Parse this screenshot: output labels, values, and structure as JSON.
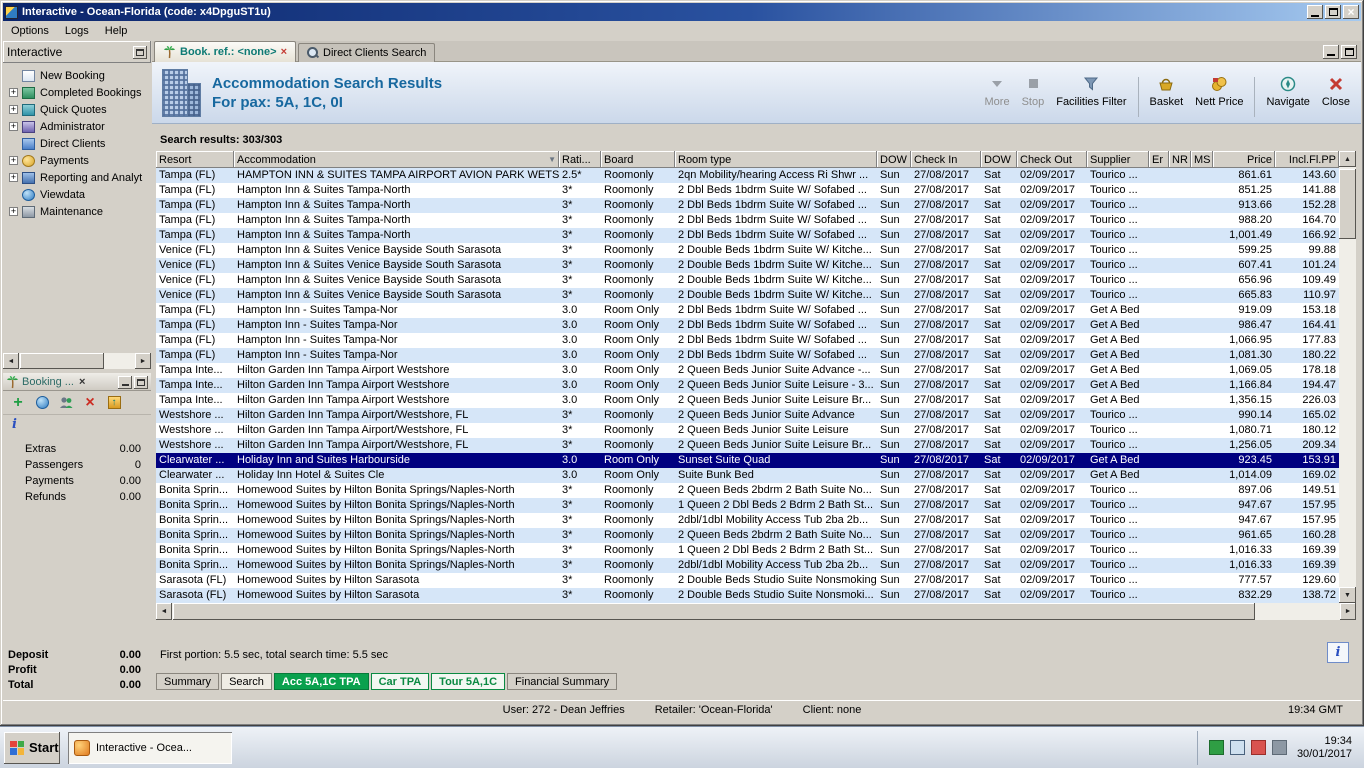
{
  "window": {
    "title": "Interactive - Ocean-Florida (code: x4DpguST1u)",
    "menu": [
      "Options",
      "Logs",
      "Help"
    ]
  },
  "sidebar": {
    "title": "Interactive",
    "items": [
      {
        "label": "New Booking",
        "icon": "new-booking-icon"
      },
      {
        "label": "Completed Bookings",
        "icon": "completed-bookings-icon",
        "expandable": true
      },
      {
        "label": "Quick Quotes",
        "icon": "quick-quotes-icon",
        "expandable": true
      },
      {
        "label": "Administrator",
        "icon": "administrator-icon",
        "expandable": true
      },
      {
        "label": "Direct Clients",
        "icon": "direct-clients-icon"
      },
      {
        "label": "Payments",
        "icon": "payments-icon",
        "expandable": true
      },
      {
        "label": "Reporting and Analyt",
        "icon": "reporting-icon",
        "expandable": true
      },
      {
        "label": "Viewdata",
        "icon": "viewdata-icon"
      },
      {
        "label": "Maintenance",
        "icon": "maintenance-icon",
        "expandable": true
      }
    ]
  },
  "booking_panel": {
    "title": "Booking ...",
    "toolbar_icons": [
      "add-icon",
      "globe-icon",
      "add-passenger-icon",
      "delete-icon",
      "export-icon",
      "info-icon"
    ],
    "fields": [
      {
        "label": "Extras",
        "value": "0.00"
      },
      {
        "label": "Passengers",
        "value": "0"
      },
      {
        "label": "Payments",
        "value": "0.00"
      },
      {
        "label": "Refunds",
        "value": "0.00"
      }
    ],
    "totals": [
      {
        "label": "Deposit",
        "value": "0.00"
      },
      {
        "label": "Profit",
        "value": "0.00"
      },
      {
        "label": "Total",
        "value": "0.00"
      }
    ]
  },
  "main": {
    "tabs": [
      {
        "label": "Book. ref.: <none>",
        "active": true
      },
      {
        "label": "Direct Clients Search"
      }
    ],
    "header": {
      "title": "Accommodation Search Results",
      "subtitle": "For pax: 5A, 1C, 0I"
    },
    "toolbar": [
      {
        "label": "More",
        "icon": "more-icon",
        "disabled": true
      },
      {
        "label": "Stop",
        "icon": "stop-icon",
        "disabled": true
      },
      {
        "label": "Facilities Filter",
        "icon": "facilities-filter-icon"
      },
      {
        "label": "Basket",
        "icon": "basket-icon"
      },
      {
        "label": "Nett Price",
        "icon": "nett-price-icon"
      },
      {
        "label": "Navigate",
        "icon": "navigate-icon"
      },
      {
        "label": "Close",
        "icon": "close-icon"
      }
    ],
    "results_label": "Search results: 303/303",
    "status_line": "First portion: 5.5 sec, total search time: 5.5 sec",
    "bottom_tabs": [
      {
        "label": "Summary"
      },
      {
        "label": "Search",
        "active": true
      },
      {
        "label": "Acc 5A,1C TPA",
        "filled": true
      },
      {
        "label": "Car TPA",
        "outline": true
      },
      {
        "label": "Tour 5A,1C",
        "outline": true
      },
      {
        "label": "Financial Summary"
      }
    ]
  },
  "table": {
    "columns": [
      "Resort",
      "Accommodation",
      "Rati...",
      "Board",
      "Room type",
      "DOW",
      "Check In",
      "DOW",
      "Check Out",
      "Supplier",
      "Er",
      "NR",
      "MS",
      "Price",
      "Incl.Fl.PP"
    ],
    "rows": [
      {
        "r": "Tampa (FL)",
        "a": "HAMPTON INN & SUITES TAMPA AIRPORT AVION PARK WETSH...",
        "rt": "2.5*",
        "b": "Roomonly",
        "rm": "2qn Mobility/hearing Access Ri Shwr ...",
        "d1": "Sun",
        "ci": "27/08/2017",
        "d2": "Sat",
        "co": "02/09/2017",
        "s": "Tourico ...",
        "p": "861.61",
        "pp": "143.60"
      },
      {
        "r": "Tampa (FL)",
        "a": "Hampton Inn & Suites Tampa-North",
        "rt": "3*",
        "b": "Roomonly",
        "rm": "2 Dbl Beds 1bdrm Suite W/ Sofabed ...",
        "d1": "Sun",
        "ci": "27/08/2017",
        "d2": "Sat",
        "co": "02/09/2017",
        "s": "Tourico ...",
        "p": "851.25",
        "pp": "141.88"
      },
      {
        "r": "Tampa (FL)",
        "a": "Hampton Inn & Suites Tampa-North",
        "rt": "3*",
        "b": "Roomonly",
        "rm": "2 Dbl Beds 1bdrm Suite W/ Sofabed ...",
        "d1": "Sun",
        "ci": "27/08/2017",
        "d2": "Sat",
        "co": "02/09/2017",
        "s": "Tourico ...",
        "p": "913.66",
        "pp": "152.28"
      },
      {
        "r": "Tampa (FL)",
        "a": "Hampton Inn & Suites Tampa-North",
        "rt": "3*",
        "b": "Roomonly",
        "rm": "2 Dbl Beds 1bdrm Suite W/ Sofabed ...",
        "d1": "Sun",
        "ci": "27/08/2017",
        "d2": "Sat",
        "co": "02/09/2017",
        "s": "Tourico ...",
        "p": "988.20",
        "pp": "164.70"
      },
      {
        "r": "Tampa (FL)",
        "a": "Hampton Inn & Suites Tampa-North",
        "rt": "3*",
        "b": "Roomonly",
        "rm": "2 Dbl Beds 1bdrm Suite W/ Sofabed ...",
        "d1": "Sun",
        "ci": "27/08/2017",
        "d2": "Sat",
        "co": "02/09/2017",
        "s": "Tourico ...",
        "p": "1,001.49",
        "pp": "166.92"
      },
      {
        "r": "Venice (FL)",
        "a": "Hampton Inn & Suites Venice Bayside South Sarasota",
        "rt": "3*",
        "b": "Roomonly",
        "rm": "2 Double Beds 1bdrm Suite W/ Kitche...",
        "d1": "Sun",
        "ci": "27/08/2017",
        "d2": "Sat",
        "co": "02/09/2017",
        "s": "Tourico ...",
        "p": "599.25",
        "pp": "99.88"
      },
      {
        "r": "Venice (FL)",
        "a": "Hampton Inn & Suites Venice Bayside South Sarasota",
        "rt": "3*",
        "b": "Roomonly",
        "rm": "2 Double Beds 1bdrm Suite W/ Kitche...",
        "d1": "Sun",
        "ci": "27/08/2017",
        "d2": "Sat",
        "co": "02/09/2017",
        "s": "Tourico ...",
        "p": "607.41",
        "pp": "101.24"
      },
      {
        "r": "Venice (FL)",
        "a": "Hampton Inn & Suites Venice Bayside South Sarasota",
        "rt": "3*",
        "b": "Roomonly",
        "rm": "2 Double Beds 1bdrm Suite W/ Kitche...",
        "d1": "Sun",
        "ci": "27/08/2017",
        "d2": "Sat",
        "co": "02/09/2017",
        "s": "Tourico ...",
        "p": "656.96",
        "pp": "109.49"
      },
      {
        "r": "Venice (FL)",
        "a": "Hampton Inn & Suites Venice Bayside South Sarasota",
        "rt": "3*",
        "b": "Roomonly",
        "rm": "2 Double Beds 1bdrm Suite W/ Kitche...",
        "d1": "Sun",
        "ci": "27/08/2017",
        "d2": "Sat",
        "co": "02/09/2017",
        "s": "Tourico ...",
        "p": "665.83",
        "pp": "110.97"
      },
      {
        "r": "Tampa (FL)",
        "a": "Hampton Inn - Suites Tampa-Nor",
        "rt": "3.0",
        "b": "Room Only",
        "rm": "2 Dbl Beds 1bdrm Suite W/ Sofabed ...",
        "d1": "Sun",
        "ci": "27/08/2017",
        "d2": "Sat",
        "co": "02/09/2017",
        "s": "Get A Bed",
        "p": "919.09",
        "pp": "153.18"
      },
      {
        "r": "Tampa (FL)",
        "a": "Hampton Inn - Suites Tampa-Nor",
        "rt": "3.0",
        "b": "Room Only",
        "rm": "2 Dbl Beds 1bdrm Suite W/ Sofabed ...",
        "d1": "Sun",
        "ci": "27/08/2017",
        "d2": "Sat",
        "co": "02/09/2017",
        "s": "Get A Bed",
        "p": "986.47",
        "pp": "164.41"
      },
      {
        "r": "Tampa (FL)",
        "a": "Hampton Inn - Suites Tampa-Nor",
        "rt": "3.0",
        "b": "Room Only",
        "rm": "2 Dbl Beds 1bdrm Suite W/ Sofabed ...",
        "d1": "Sun",
        "ci": "27/08/2017",
        "d2": "Sat",
        "co": "02/09/2017",
        "s": "Get A Bed",
        "p": "1,066.95",
        "pp": "177.83"
      },
      {
        "r": "Tampa (FL)",
        "a": "Hampton Inn - Suites Tampa-Nor",
        "rt": "3.0",
        "b": "Room Only",
        "rm": "2 Dbl Beds 1bdrm Suite W/ Sofabed ...",
        "d1": "Sun",
        "ci": "27/08/2017",
        "d2": "Sat",
        "co": "02/09/2017",
        "s": "Get A Bed",
        "p": "1,081.30",
        "pp": "180.22"
      },
      {
        "r": "Tampa Inte...",
        "a": "Hilton Garden Inn Tampa Airport Westshore",
        "rt": "3.0",
        "b": "Room Only",
        "rm": "2 Queen Beds Junior Suite Advance -...",
        "d1": "Sun",
        "ci": "27/08/2017",
        "d2": "Sat",
        "co": "02/09/2017",
        "s": "Get A Bed",
        "p": "1,069.05",
        "pp": "178.18"
      },
      {
        "r": "Tampa Inte...",
        "a": "Hilton Garden Inn Tampa Airport Westshore",
        "rt": "3.0",
        "b": "Room Only",
        "rm": "2 Queen Beds Junior Suite Leisure - 3...",
        "d1": "Sun",
        "ci": "27/08/2017",
        "d2": "Sat",
        "co": "02/09/2017",
        "s": "Get A Bed",
        "p": "1,166.84",
        "pp": "194.47"
      },
      {
        "r": "Tampa Inte...",
        "a": "Hilton Garden Inn Tampa Airport Westshore",
        "rt": "3.0",
        "b": "Room Only",
        "rm": "2 Queen Beds Junior Suite Leisure Br...",
        "d1": "Sun",
        "ci": "27/08/2017",
        "d2": "Sat",
        "co": "02/09/2017",
        "s": "Get A Bed",
        "p": "1,356.15",
        "pp": "226.03"
      },
      {
        "r": "Westshore ...",
        "a": "Hilton Garden Inn Tampa Airport/Westshore, FL",
        "rt": "3*",
        "b": "Roomonly",
        "rm": "2 Queen Beds Junior Suite Advance",
        "d1": "Sun",
        "ci": "27/08/2017",
        "d2": "Sat",
        "co": "02/09/2017",
        "s": "Tourico ...",
        "p": "990.14",
        "pp": "165.02"
      },
      {
        "r": "Westshore ...",
        "a": "Hilton Garden Inn Tampa Airport/Westshore, FL",
        "rt": "3*",
        "b": "Roomonly",
        "rm": "2 Queen Beds Junior Suite Leisure",
        "d1": "Sun",
        "ci": "27/08/2017",
        "d2": "Sat",
        "co": "02/09/2017",
        "s": "Tourico ...",
        "p": "1,080.71",
        "pp": "180.12"
      },
      {
        "r": "Westshore ...",
        "a": "Hilton Garden Inn Tampa Airport/Westshore, FL",
        "rt": "3*",
        "b": "Roomonly",
        "rm": "2 Queen Beds Junior Suite Leisure Br...",
        "d1": "Sun",
        "ci": "27/08/2017",
        "d2": "Sat",
        "co": "02/09/2017",
        "s": "Tourico ...",
        "p": "1,256.05",
        "pp": "209.34"
      },
      {
        "r": "Clearwater ...",
        "a": "Holiday Inn and Suites Harbourside",
        "rt": "3.0",
        "b": "Room Only",
        "rm": "Sunset Suite Quad",
        "d1": "Sun",
        "ci": "27/08/2017",
        "d2": "Sat",
        "co": "02/09/2017",
        "s": "Get A Bed",
        "p": "923.45",
        "pp": "153.91",
        "selected": true
      },
      {
        "r": "Clearwater ...",
        "a": "Holiday Inn Hotel & Suites Cle",
        "rt": "3.0",
        "b": "Room Only",
        "rm": "Suite Bunk Bed",
        "d1": "Sun",
        "ci": "27/08/2017",
        "d2": "Sat",
        "co": "02/09/2017",
        "s": "Get A Bed",
        "p": "1,014.09",
        "pp": "169.02"
      },
      {
        "r": "Bonita Sprin...",
        "a": "Homewood Suites by Hilton Bonita Springs/Naples-North",
        "rt": "3*",
        "b": "Roomonly",
        "rm": "2 Queen Beds 2bdrm 2 Bath Suite No...",
        "d1": "Sun",
        "ci": "27/08/2017",
        "d2": "Sat",
        "co": "02/09/2017",
        "s": "Tourico ...",
        "p": "897.06",
        "pp": "149.51"
      },
      {
        "r": "Bonita Sprin...",
        "a": "Homewood Suites by Hilton Bonita Springs/Naples-North",
        "rt": "3*",
        "b": "Roomonly",
        "rm": "1 Queen 2 Dbl Beds 2 Bdrm 2 Bath St...",
        "d1": "Sun",
        "ci": "27/08/2017",
        "d2": "Sat",
        "co": "02/09/2017",
        "s": "Tourico ...",
        "p": "947.67",
        "pp": "157.95"
      },
      {
        "r": "Bonita Sprin...",
        "a": "Homewood Suites by Hilton Bonita Springs/Naples-North",
        "rt": "3*",
        "b": "Roomonly",
        "rm": "2dbl/1dbl Mobility Access Tub 2ba 2b...",
        "d1": "Sun",
        "ci": "27/08/2017",
        "d2": "Sat",
        "co": "02/09/2017",
        "s": "Tourico ...",
        "p": "947.67",
        "pp": "157.95"
      },
      {
        "r": "Bonita Sprin...",
        "a": "Homewood Suites by Hilton Bonita Springs/Naples-North",
        "rt": "3*",
        "b": "Roomonly",
        "rm": "2 Queen Beds 2bdrm 2 Bath Suite No...",
        "d1": "Sun",
        "ci": "27/08/2017",
        "d2": "Sat",
        "co": "02/09/2017",
        "s": "Tourico ...",
        "p": "961.65",
        "pp": "160.28"
      },
      {
        "r": "Bonita Sprin...",
        "a": "Homewood Suites by Hilton Bonita Springs/Naples-North",
        "rt": "3*",
        "b": "Roomonly",
        "rm": "1 Queen 2 Dbl Beds 2 Bdrm 2 Bath St...",
        "d1": "Sun",
        "ci": "27/08/2017",
        "d2": "Sat",
        "co": "02/09/2017",
        "s": "Tourico ...",
        "p": "1,016.33",
        "pp": "169.39"
      },
      {
        "r": "Bonita Sprin...",
        "a": "Homewood Suites by Hilton Bonita Springs/Naples-North",
        "rt": "3*",
        "b": "Roomonly",
        "rm": "2dbl/1dbl Mobility Access Tub 2ba 2b...",
        "d1": "Sun",
        "ci": "27/08/2017",
        "d2": "Sat",
        "co": "02/09/2017",
        "s": "Tourico ...",
        "p": "1,016.33",
        "pp": "169.39"
      },
      {
        "r": "Sarasota (FL)",
        "a": "Homewood Suites by Hilton Sarasota",
        "rt": "3*",
        "b": "Roomonly",
        "rm": "2 Double Beds Studio Suite Nonsmoking",
        "d1": "Sun",
        "ci": "27/08/2017",
        "d2": "Sat",
        "co": "02/09/2017",
        "s": "Tourico ...",
        "p": "777.57",
        "pp": "129.60"
      },
      {
        "r": "Sarasota (FL)",
        "a": "Homewood Suites by Hilton Sarasota",
        "rt": "3*",
        "b": "Roomonly",
        "rm": "2 Double Beds Studio Suite Nonsmoki...",
        "d1": "Sun",
        "ci": "27/08/2017",
        "d2": "Sat",
        "co": "02/09/2017",
        "s": "Tourico ...",
        "p": "832.29",
        "pp": "138.72"
      }
    ]
  },
  "footer": {
    "user": "User: 272 - Dean Jeffries",
    "retailer": "Retailer: 'Ocean-Florida'",
    "client": "Client: none",
    "time": "19:34 GMT"
  },
  "taskbar": {
    "start": "Start",
    "task": "Interactive - Ocea...",
    "time": "19:34",
    "date": "30/01/2017"
  }
}
